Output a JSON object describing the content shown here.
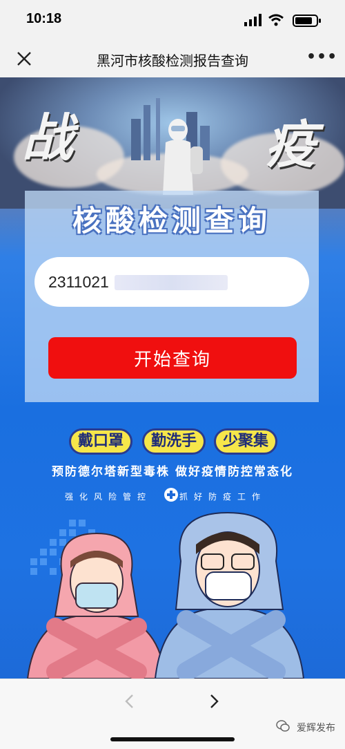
{
  "status_bar": {
    "time": "10:18"
  },
  "nav": {
    "title": "黑河市核酸检测报告查询"
  },
  "poster": {
    "left_char": "战",
    "right_char": "疫",
    "card_title": "核酸检测查询",
    "id_input_value": "2311021",
    "query_button_label": "开始查询",
    "pills": [
      "戴口罩",
      "勤洗手",
      "少聚集"
    ],
    "slogan": "预防德尔塔新型毒株  做好疫情防控常态化",
    "sub_slogan_left": "强化风险管控",
    "sub_slogan_right": "抓好防疫工作"
  },
  "footer": {
    "watermark": "爱辉发布"
  },
  "colors": {
    "accent_red": "#f00f0f",
    "pill_yellow": "#f6e64a",
    "poster_blue": "#1a6fe0"
  }
}
